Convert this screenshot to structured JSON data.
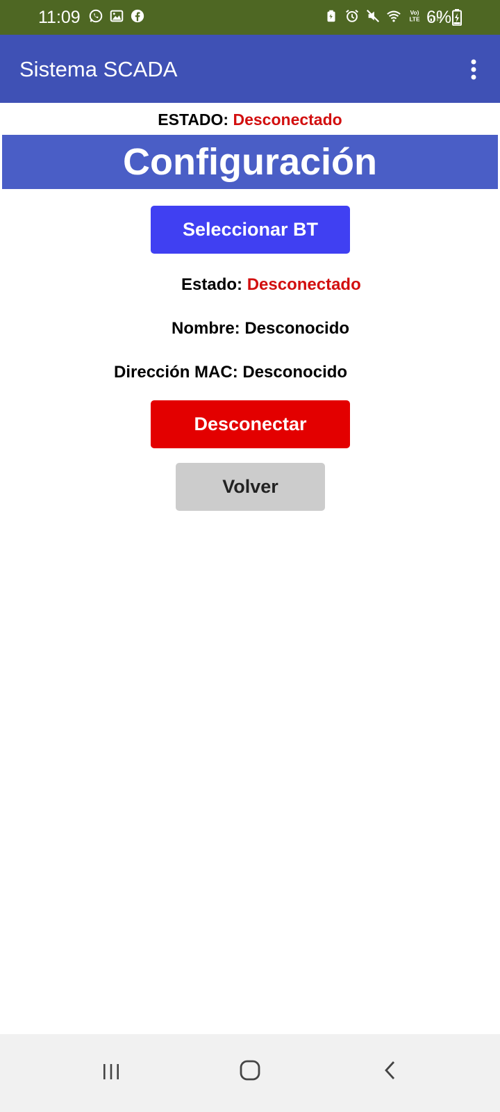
{
  "status_bar": {
    "time": "11:09",
    "battery_percent": "6%",
    "left_icons": [
      "whatsapp-icon",
      "gallery-icon",
      "facebook-icon"
    ],
    "right_icons": [
      "battery-saver-icon",
      "alarm-icon",
      "mute-icon",
      "wifi-icon",
      "volte-icon",
      "signal-icon"
    ],
    "volte_label": "Vo) LTE",
    "color": "#4e6723"
  },
  "app_bar": {
    "title": "Sistema SCADA",
    "color": "#3f51b5"
  },
  "global_status": {
    "label": "ESTADO:",
    "value": "Desconectado",
    "value_color": "#d20f0f"
  },
  "section": {
    "title": "Configuración",
    "color": "#4a5ec6"
  },
  "buttons": {
    "select_bt": "Seleccionar BT",
    "disconnect": "Desconectar",
    "back": "Volver"
  },
  "device_info": {
    "estado_label": "Estado:",
    "estado_value": "Desconectado",
    "nombre_label": "Nombre:",
    "nombre_value": "Desconocido",
    "mac_label": "Dirección MAC:",
    "mac_value": "Desconocido"
  },
  "nav_bar": {
    "icons": [
      "recent-apps-icon",
      "home-icon",
      "back-icon"
    ]
  }
}
